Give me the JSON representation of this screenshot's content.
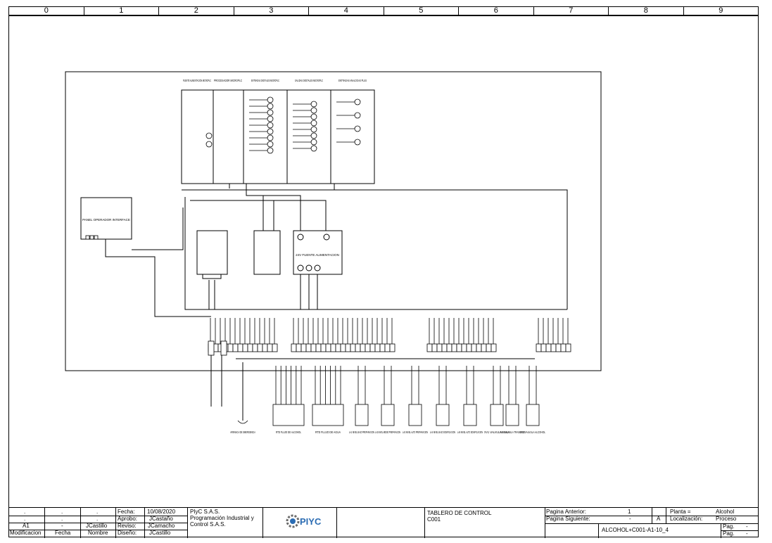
{
  "ruler": [
    "0",
    "1",
    "2",
    "3",
    "4",
    "5",
    "6",
    "7",
    "8",
    "9"
  ],
  "modules": [
    {
      "label": "FUENTE ALIMENTACION MICROPLC"
    },
    {
      "label": "PROCESADOR MICROPLC"
    },
    {
      "label": "ENTRADAS DIGITALES MICROPLC"
    },
    {
      "label": "SALIDAS DIGITALES MICROPLC"
    },
    {
      "label": "ENTRADAS ANALOGAS PLUS"
    }
  ],
  "panel_label": "PANEL OPERADOR INTERFACE",
  "psu_label": "24V FUENTE ALIMENTACION",
  "devices": [
    {
      "label": "ARRANCA DE EMERGENCIA"
    },
    {
      "label": "RTD FLUJO DE ALCOHOL"
    },
    {
      "label": "RTD FLUJO DE AGUA"
    },
    {
      "label": "LA1 NIVEL BAJO PREPARACION"
    },
    {
      "label": "LA2 NIVEL MEDIO PREPARACION"
    },
    {
      "label": "LA3 NIVEL ALTO PREPARACION"
    },
    {
      "label": "LA4 NIVEL BAJO DOSIFICACION"
    },
    {
      "label": "LA5 NIVEL ALTO DOSIFICACION"
    },
    {
      "label": "XV1 VALVULA AGUA"
    },
    {
      "label": "XV2 VALVULA TRASIEGO"
    },
    {
      "label": "XV3 VALVULA ALCOHOL"
    }
  ],
  "title_block": {
    "rev_rows": [
      [
        ".",
        ".",
        "."
      ],
      [
        ".",
        ".",
        "."
      ],
      [
        "A1",
        "-",
        "JCastillo"
      ]
    ],
    "rev_headers": [
      "Modificacion",
      "Fecha",
      "Nombre"
    ],
    "fecha_label": "Fecha:",
    "fecha_value": "10/08/2020",
    "aprobo_label": "Aprobo:",
    "aprobo_value": "JCastaño",
    "reviso_label": "Reviso:",
    "reviso_value": "JCamacho",
    "diseno_label": "Diseño:",
    "diseno_value": "JCastillo",
    "company_line1": "PIyC S.A.S.",
    "company_line2": "Programación Industrial y",
    "company_line3": "Control S.A.S.",
    "logo_text": "PIYC",
    "drawing_title1": "TABLERO DE CONTROL",
    "drawing_title2": "C001",
    "pag_anterior_label": "Pagina Anterior:",
    "pag_anterior_value": "1",
    "pag_siguiente_label": "Pagina Siguiente:",
    "pag_siguiente_value": "-",
    "planta_label": "Planta =",
    "planta_value": "Alcohol",
    "rev_letter": "A",
    "localizacion_label": "Localización:",
    "localizacion_value": "Proceso",
    "doc_code": "ALCOHOL+C001-A1-10_4",
    "pag_label1": "Pag.",
    "pag_value1": "-",
    "pag_label2": "Pag.",
    "pag_value2": "-"
  },
  "colors": {
    "line": "#000000",
    "logo_blue": "#2b6cb3",
    "logo_gear": "#6b6b6b"
  }
}
